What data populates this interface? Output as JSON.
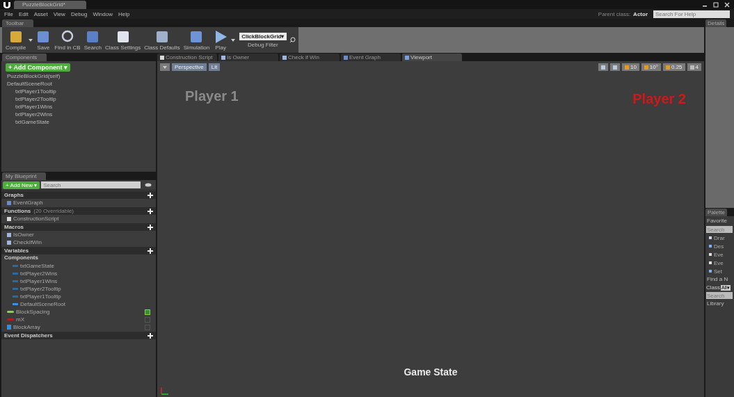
{
  "window": {
    "tab": "PuzzleBlockGrid*"
  },
  "menu": [
    "File",
    "Edit",
    "Asset",
    "View",
    "Debug",
    "Window",
    "Help"
  ],
  "parent_class": {
    "label": "Parent class:",
    "value": "Actor"
  },
  "help_search": {
    "placeholder": "Search For Help"
  },
  "toolbar_tab": "Toolbar",
  "toolbar": [
    {
      "kind": "compile",
      "label": "Compile",
      "dropdown": true
    },
    {
      "kind": "save",
      "label": "Save",
      "dropdown": false
    },
    {
      "kind": "find",
      "label": "Find in CB",
      "dropdown": false
    },
    {
      "kind": "search",
      "label": "Search",
      "dropdown": false
    },
    {
      "kind": "settings",
      "label": "Class Settings",
      "dropdown": false
    },
    {
      "kind": "defaults",
      "label": "Class Defaults",
      "dropdown": false
    },
    {
      "kind": "simulation",
      "label": "Simulation",
      "dropdown": false
    },
    {
      "kind": "play",
      "label": "Play",
      "dropdown": true
    }
  ],
  "debug_filter": {
    "value": "ClickBlockGrid▾",
    "label": "Debug Filter"
  },
  "components": {
    "tab": "Components",
    "add_button": "+ Add Component ▾",
    "self": "PuzzleBlockGrid(self)",
    "root": {
      "label": "DefaultSceneRoot",
      "children": [
        {
          "label": "txtPlayer1Tooltip"
        },
        {
          "label": "txtPlayer2Tooltip"
        },
        {
          "label": "txtPlayer1Wins"
        },
        {
          "label": "txtPlayer2Wins"
        },
        {
          "label": "txtGameState"
        }
      ]
    }
  },
  "my_blueprint": {
    "tab": "My Blueprint",
    "add_button": "+ Add New ▾",
    "search": {
      "placeholder": "Search"
    },
    "sections": [
      {
        "title": "Graphs",
        "add": true,
        "items": [
          {
            "label": "EventGraph",
            "kind": "graph"
          }
        ]
      },
      {
        "title": "Functions",
        "note": "(20 Overridable)",
        "add": true,
        "items": [
          {
            "label": "ConstructionScript",
            "kind": "function"
          }
        ]
      },
      {
        "title": "Macros",
        "add": true,
        "items": [
          {
            "label": "IsOwner",
            "kind": "macro"
          },
          {
            "label": "CheckIfWin",
            "kind": "macro"
          }
        ]
      },
      {
        "title": "Variables",
        "add": true
      }
    ],
    "component_vars": {
      "title": "Components",
      "items": [
        {
          "label": "txtGameState",
          "kind": "text"
        },
        {
          "label": "txtPlayer2Wins",
          "kind": "text"
        },
        {
          "label": "txtPlayer1Wins",
          "kind": "text"
        },
        {
          "label": "txtPlayer2Tooltip",
          "kind": "text"
        },
        {
          "label": "txtPlayer1Tooltip",
          "kind": "text"
        },
        {
          "label": "DefaultSceneRoot",
          "kind": "scene"
        }
      ]
    },
    "variables": [
      {
        "label": "BlockSpacing",
        "color": "#8fd14f",
        "kind": "single",
        "visible": true
      },
      {
        "label": "mX",
        "color": "#b01d1d",
        "kind": "single",
        "visible": false
      },
      {
        "label": "BlockArray",
        "color": "#2f8fe0",
        "kind": "array",
        "visible": false
      }
    ],
    "dispatchers": {
      "title": "Event Dispatchers",
      "add": true
    }
  },
  "editor_tabs": [
    {
      "label": "Construction Script",
      "kind": "function",
      "selected": false
    },
    {
      "label": "Is Owner",
      "kind": "macro",
      "selected": false
    },
    {
      "label": "Check if Win",
      "kind": "macro",
      "selected": false
    },
    {
      "label": "Event Graph",
      "kind": "graph",
      "selected": false
    },
    {
      "label": "Viewport",
      "kind": "viewport",
      "selected": true
    }
  ],
  "viewport": {
    "view_mode": "Perspective",
    "lighting": "Lit",
    "snap": [
      {
        "kind": "transform"
      },
      {
        "kind": "camera"
      },
      {
        "kind": "grid",
        "label": "10"
      },
      {
        "kind": "rotate",
        "label": "10°"
      },
      {
        "kind": "scale",
        "label": "0.25"
      },
      {
        "kind": "speed",
        "label": "4"
      }
    ],
    "texts": [
      {
        "label": "Player 1",
        "kind": "p1"
      },
      {
        "label": "Player 2",
        "kind": "p2"
      },
      {
        "label": "Game State",
        "kind": "state"
      }
    ]
  },
  "details": {
    "tab": "Details"
  },
  "palette": {
    "tab": "Palette",
    "favorites": "Favorite",
    "search": {
      "placeholder": "Search"
    },
    "items": [
      {
        "label": "Drar",
        "kind": "cast"
      },
      {
        "label": "Des",
        "kind": "function"
      },
      {
        "label": "Eve",
        "kind": "event"
      },
      {
        "label": "Eve",
        "kind": "event"
      },
      {
        "label": "Set",
        "kind": "function"
      }
    ],
    "find": "Find a N",
    "class_label": "Class",
    "class_value": "All▾",
    "search2": {
      "placeholder": "Search"
    },
    "library": "Library"
  }
}
